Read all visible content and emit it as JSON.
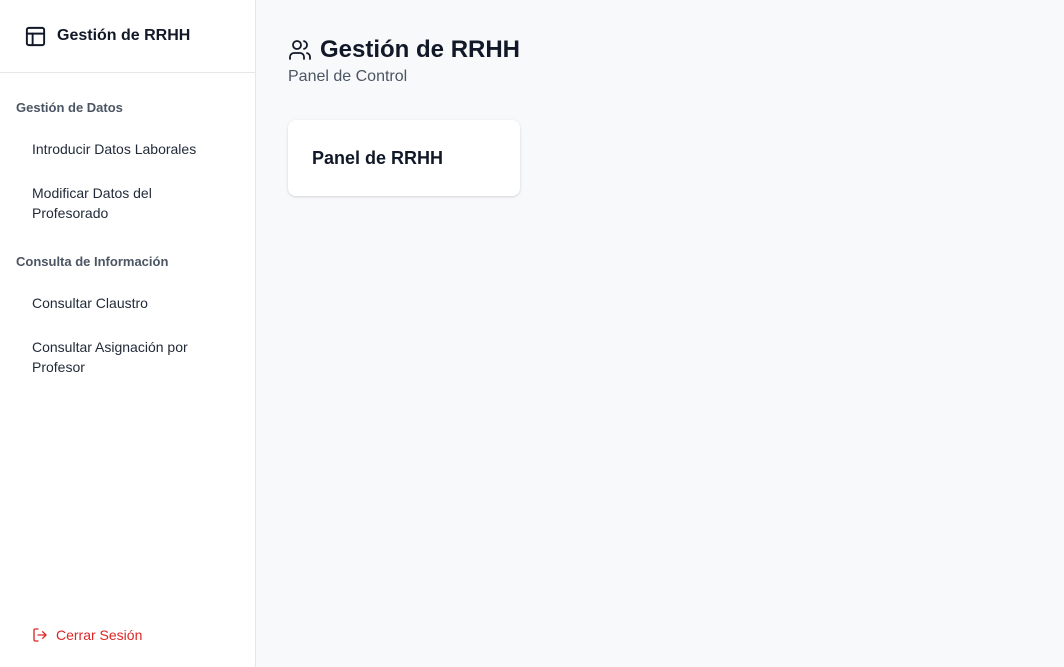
{
  "sidebar": {
    "brand": {
      "title": "Gestión de RRHH",
      "icon": "layout-panel-icon"
    },
    "sections": [
      {
        "title": "Gestión de Datos",
        "items": [
          {
            "label": "Introducir Datos Laborales"
          },
          {
            "label": "Modificar Datos del Profesorado"
          }
        ]
      },
      {
        "title": "Consulta de Información",
        "items": [
          {
            "label": "Consultar Claustro"
          },
          {
            "label": "Consultar Asignación por Profesor"
          }
        ]
      }
    ],
    "logout": {
      "label": "Cerrar Sesión",
      "icon": "log-out-icon",
      "color": "#dc2626"
    }
  },
  "main": {
    "title": "Gestión de RRHH",
    "title_icon": "users-icon",
    "subtitle": "Panel de Control",
    "cards": [
      {
        "title": "Panel de RRHH"
      }
    ]
  },
  "colors": {
    "background": "#f8f9fb",
    "sidebar_bg": "#ffffff",
    "danger": "#dc2626",
    "muted_text": "#4b5563"
  }
}
